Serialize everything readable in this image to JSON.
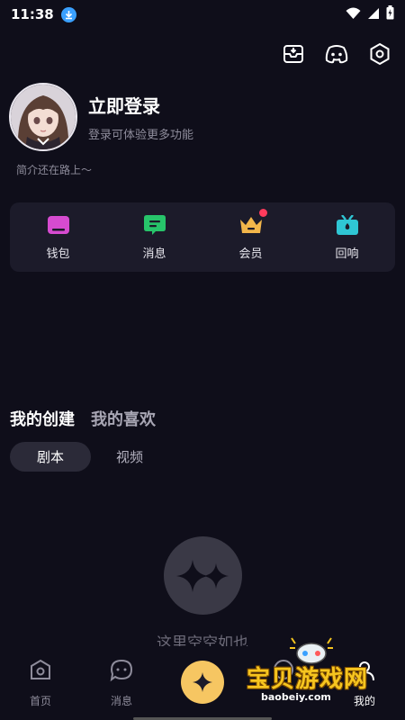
{
  "status_bar": {
    "time": "11:38",
    "icons": [
      "download-icon",
      "wifi-icon",
      "signal-icon",
      "battery-icon"
    ]
  },
  "header": {
    "actions": [
      "inbox-icon",
      "discord-icon",
      "settings-icon"
    ]
  },
  "profile": {
    "title": "立即登录",
    "subtitle": "登录可体验更多功能",
    "bio": "简介还在路上～"
  },
  "quick_actions": [
    {
      "label": "钱包",
      "icon": "wallet-icon",
      "color": "#d64bd0",
      "badge": false
    },
    {
      "label": "消息",
      "icon": "message-icon",
      "color": "#27c46a",
      "badge": false
    },
    {
      "label": "会员",
      "icon": "crown-icon",
      "color": "#f2b64a",
      "badge": true
    },
    {
      "label": "回响",
      "icon": "gift-icon",
      "color": "#2fc6d4",
      "badge": false
    }
  ],
  "tabs": {
    "created": "我的创建",
    "liked": "我的喜欢"
  },
  "subtabs": {
    "script": "剧本",
    "video": "视频"
  },
  "empty_state": {
    "text": "这里空空如也"
  },
  "bottom_nav": [
    {
      "label": "首页",
      "icon": "home-icon"
    },
    {
      "label": "消息",
      "icon": "chat-icon"
    },
    {
      "label": "",
      "icon": "sparkle-icon"
    },
    {
      "label": "",
      "icon": "compass-icon"
    },
    {
      "label": "我的",
      "icon": "user-icon"
    }
  ],
  "watermark": {
    "title": "宝贝游戏网",
    "url": "baobeiy.com"
  },
  "colors": {
    "background": "#0f0e1a",
    "card": "#1c1b2a",
    "accent": "#f6c662",
    "badge": "#ff3b5c"
  }
}
